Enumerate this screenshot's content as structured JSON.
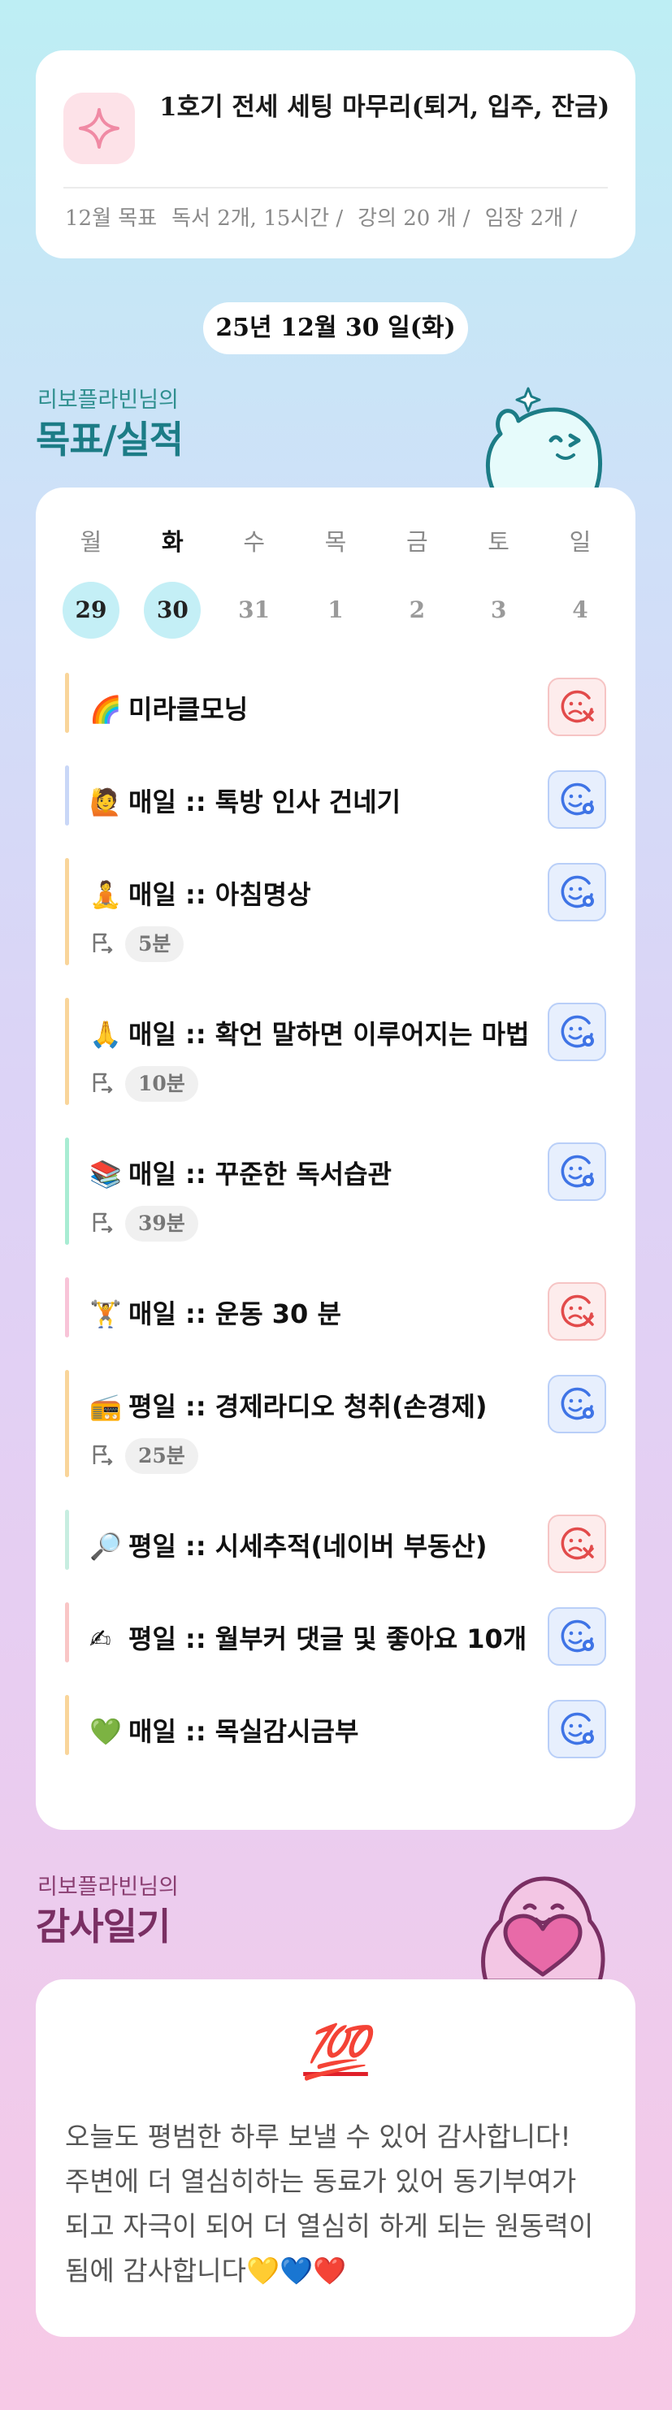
{
  "goal": {
    "title": "1호기 전세 세팅 마무리(퇴거, 입주, 잔금)",
    "meta": [
      "12월 목표",
      "독서 2개, 15시간 /",
      "강의 20 개 /",
      "임장 2개 /"
    ],
    "icon": "sparkle-icon"
  },
  "date": "25년 12월 30 일(화)",
  "goals_section": {
    "subtitle": "리보플라빈님의",
    "title": "목표/실적"
  },
  "week": [
    {
      "day": "월",
      "num": "29",
      "highlight": true,
      "today": false
    },
    {
      "day": "화",
      "num": "30",
      "highlight": true,
      "today": true
    },
    {
      "day": "수",
      "num": "31",
      "highlight": false,
      "today": false
    },
    {
      "day": "목",
      "num": "1",
      "highlight": false,
      "today": false
    },
    {
      "day": "금",
      "num": "2",
      "highlight": false,
      "today": false
    },
    {
      "day": "토",
      "num": "3",
      "highlight": false,
      "today": false
    },
    {
      "day": "일",
      "num": "4",
      "highlight": false,
      "today": false
    }
  ],
  "tasks": [
    {
      "emoji": "🌈",
      "title": "미라클모닝",
      "duration": "",
      "status": "fail",
      "bar_color": "#f9d59a"
    },
    {
      "emoji": "🙋",
      "title": "매일 :: 톡방 인사 건네기",
      "duration": "",
      "status": "done",
      "bar_color": "#c9d7f7"
    },
    {
      "emoji": "🧘",
      "title": "매일 :: 아침명상",
      "duration": "5분",
      "status": "done",
      "bar_color": "#f9d59a"
    },
    {
      "emoji": "🙏",
      "title": "매일 :: 확언 말하면 이루어지는 마법",
      "duration": "10분",
      "status": "done",
      "bar_color": "#f9d59a"
    },
    {
      "emoji": "📚",
      "title": "매일 :: 꾸준한 독서습관",
      "duration": "39분",
      "status": "done",
      "bar_color": "#a8ecd3"
    },
    {
      "emoji": "🏋",
      "title": "매일 :: 운동 30 분",
      "duration": "",
      "status": "fail",
      "bar_color": "#f8c4d8"
    },
    {
      "emoji": "📻",
      "title": "평일 :: 경제라디오 청취(손경제)",
      "duration": "25분",
      "status": "done",
      "bar_color": "#f9d59a"
    },
    {
      "emoji": "🔎",
      "title": "평일 :: 시세추적(네이버 부동산)",
      "duration": "",
      "status": "fail",
      "bar_color": "#c7ede0"
    },
    {
      "emoji": "✍",
      "title": "평일 :: 월부커 댓글 및 좋아요 10개",
      "duration": "",
      "status": "done",
      "bar_color": "#f9c6c6"
    },
    {
      "emoji": "💚",
      "title": "매일 :: 목실감시금부",
      "duration": "",
      "status": "done",
      "bar_color": "#f9d59a"
    }
  ],
  "thanks_section": {
    "subtitle": "리보플라빈님의",
    "title": "감사일기"
  },
  "thanks": {
    "emoji": "💯",
    "text": "오늘도 평범한 하루 보낼 수 있어 감사합니다! 주변에 더 열심히하는 동료가 있어 동기부여가 되고 자극이 되어 더 열심히 하게 되는 원동력이 됨에 감사합니다💛💙❤️"
  },
  "colors": {
    "done": "#3f74e6",
    "fail": "#e24b4b",
    "teal": "#1c7c86",
    "plum": "#7a2f63"
  }
}
